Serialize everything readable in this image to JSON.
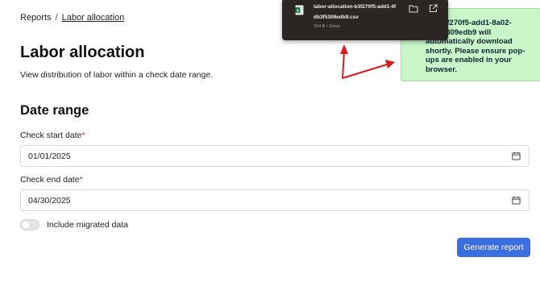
{
  "breadcrumb": {
    "root": "Reports",
    "separator": "/",
    "current": "Labor allocation"
  },
  "page": {
    "title": "Labor allocation",
    "subtitle": "View distribution of labor within a check date range."
  },
  "date_range": {
    "heading": "Date range",
    "start": {
      "label": "Check start date",
      "required_mark": "*",
      "value": "01/01/2025",
      "icon": "calendar-icon"
    },
    "end": {
      "label": "Check end date",
      "required_mark": "*",
      "value": "04/30/2025",
      "icon": "calendar-icon"
    }
  },
  "migrated_toggle": {
    "label": "Include migrated data",
    "checked": false
  },
  "actions": {
    "generate_label": "Generate report"
  },
  "toast": {
    "text": "ID: b3f270f5-add1-8a02-db3f5309edb9 will automatically download shortly. Please ensure pop-ups are enabled in your browser.",
    "background": "#c8f6c8"
  },
  "download_panel": {
    "filename_line1": "labor-allocation-b3f270f5-add1-4f",
    "filename_line2": "db3f5309edb9.csv",
    "meta": "314 B • Done",
    "file_icon": "excel-file-icon",
    "folder_icon": "folder-icon",
    "open_icon": "open-external-icon"
  },
  "colors": {
    "accent": "#3b6fe0",
    "required": "#d32f2f",
    "arrow": "#d81b1b"
  }
}
